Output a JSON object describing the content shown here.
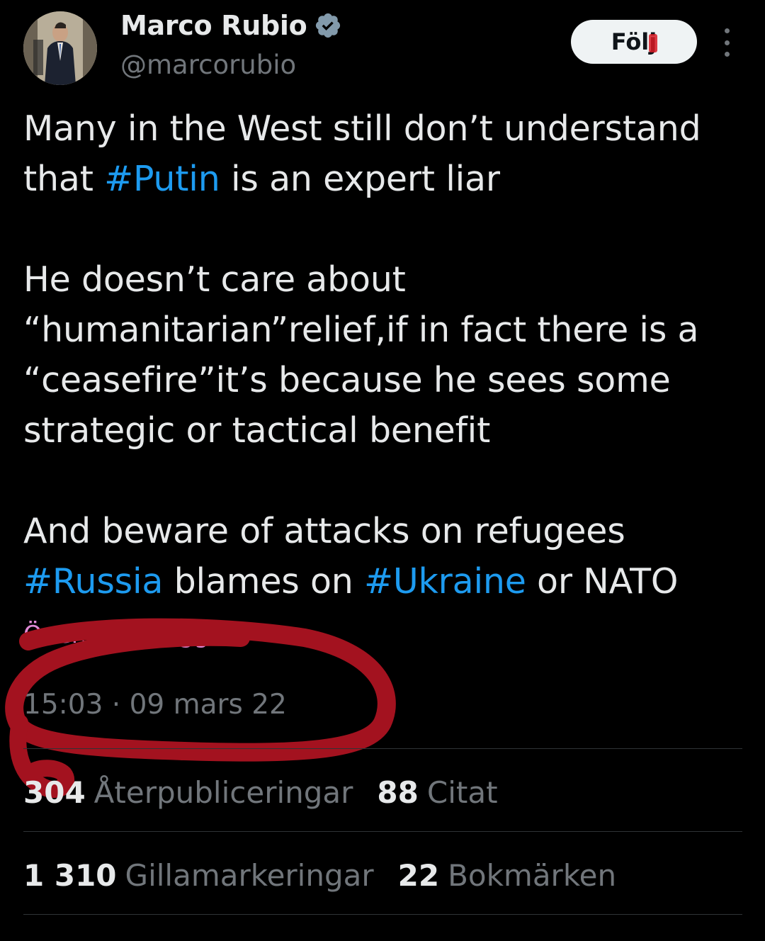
{
  "tweet": {
    "author": {
      "name": "Marco Rubio",
      "handle": "@marcorubio",
      "verified_icon": "verified-badge-icon"
    },
    "follow_label": "Följ",
    "more_icon": "more-vertical-icon",
    "text_lines": {
      "p1_a": "Many in the West still don’t understand",
      "p1_b_pre": "that ",
      "p1_b_tag": "#Putin",
      "p1_b_post": " is an expert liar",
      "p2_a": "He doesn’t care about",
      "p2_b": "“humanitarian”relief,if in fact there is a",
      "p2_c": "“ceasefire”it’s because he sees some",
      "p2_d": "strategic or tactical benefit",
      "p3_a": "And beware of attacks on refugees",
      "p3_b_tag1": "#Russia",
      "p3_b_mid": " blames on ",
      "p3_b_tag2": "#Ukraine",
      "p3_b_post": " or NATO"
    },
    "translate_label": "Översätt inlägget",
    "timestamp": "15:03 · 09 mars 22",
    "stats": {
      "reposts_num": "304",
      "reposts_label": "Återpubliceringar",
      "quotes_num": "88",
      "quotes_label": "Citat",
      "likes_num": "1 310",
      "likes_label": "Gillamarkeringar",
      "bookmarks_num": "22",
      "bookmarks_label": "Bokmärken"
    }
  },
  "colors": {
    "background": "#000000",
    "text": "#e7e9ea",
    "muted": "#71767b",
    "hashtag": "#1d9bf0",
    "annotation_red": "#a3121f"
  }
}
